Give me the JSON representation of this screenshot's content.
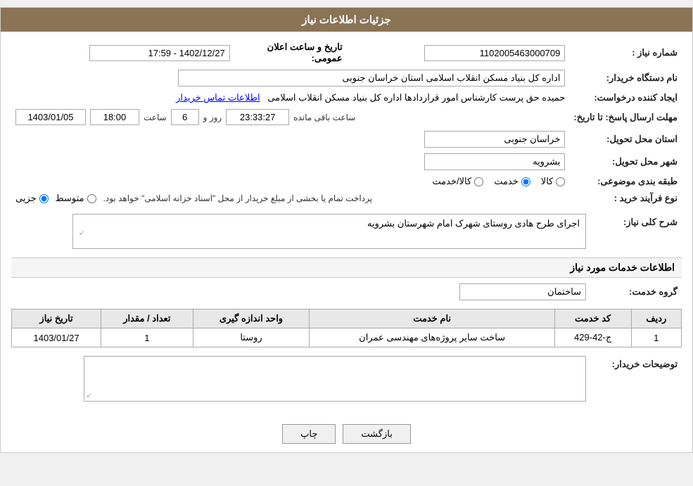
{
  "header": {
    "title": "جزئیات اطلاعات نیاز"
  },
  "fields": {
    "need_number_label": "شماره نیاز :",
    "need_number_value": "1102005463000709",
    "announcement_date_label": "تاریخ و ساعت اعلان عمومی:",
    "announcement_date_value": "1402/12/27 - 17:59",
    "buyer_name_label": "نام دستگاه خریدار:",
    "buyer_name_value": "اداره کل بنیاد مسکن انقلاب اسلامی استان خراسان جنوبی",
    "requester_label": "ایجاد کننده درخواست:",
    "requester_value": "حمیده حق پرست کارشناس امور قراردادها اداره کل بنیاد مسکن انقلاب اسلامی",
    "requester_link": "اطلاعات تماس خریدار",
    "reply_deadline_label": "مهلت ارسال پاسخ: تا تاریخ:",
    "reply_date": "1403/01/05",
    "reply_time_label": "ساعت",
    "reply_time": "18:00",
    "reply_day_label": "روز و",
    "reply_days": "6",
    "reply_remaining_label": "ساعت باقی مانده",
    "reply_remaining": "23:33:27",
    "province_label": "استان محل تحویل:",
    "province_value": "خراسان جنوبی",
    "city_label": "شهر محل تحویل:",
    "city_value": "بشرویه",
    "category_label": "طبقه بندی موضوعی:",
    "category_options": [
      {
        "label": "کالا",
        "value": "kala"
      },
      {
        "label": "خدمت",
        "value": "khedmat"
      },
      {
        "label": "کالا/خدمت",
        "value": "kala_khedmat"
      }
    ],
    "category_selected": "khedmat",
    "process_type_label": "نوع فرآیند خرید :",
    "process_type_options": [
      {
        "label": "جزیی",
        "value": "jozi"
      },
      {
        "label": "متوسط",
        "value": "motavaset"
      }
    ],
    "process_type_selected": "jozi",
    "process_type_note": "پرداخت تمام یا بخشی از مبلغ خریدار از محل \"اسناد خزانه اسلامی\" خواهد بود.",
    "need_description_label": "شرح کلی نیاز:",
    "need_description_value": "اجرای طرح هادی روستای شهرک امام شهرستان بشرویه",
    "services_section_label": "اطلاعات خدمات مورد نیاز",
    "service_group_label": "گروه خدمت:",
    "service_group_value": "ساختمان",
    "table": {
      "headers": [
        "ردیف",
        "کد خدمت",
        "نام خدمت",
        "واحد اندازه گیری",
        "تعداد / مقدار",
        "تاریخ نیاز"
      ],
      "rows": [
        {
          "row": "1",
          "code": "ج-42-429",
          "name": "ساخت سایر پروژه‌های مهندسی عمران",
          "unit": "روستا",
          "quantity": "1",
          "date": "1403/01/27"
        }
      ]
    },
    "buyer_desc_label": "توضیحات خریدار:",
    "buyer_desc_value": ""
  },
  "buttons": {
    "print_label": "چاپ",
    "back_label": "بازگشت"
  }
}
